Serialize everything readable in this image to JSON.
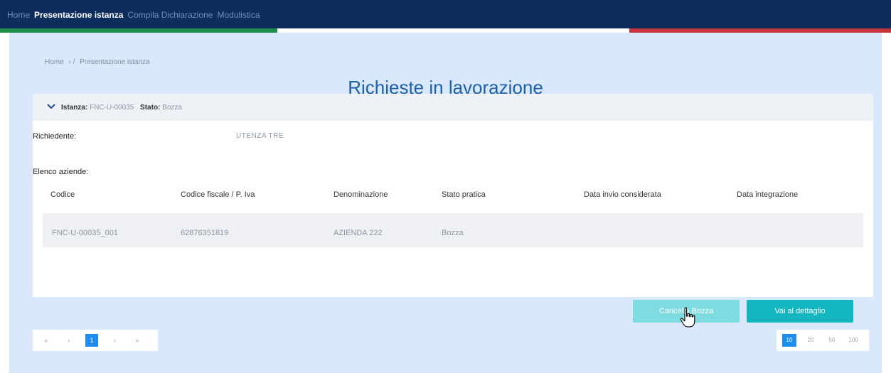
{
  "nav": {
    "items": [
      {
        "label": "Home",
        "active": false
      },
      {
        "label": "Presentazione istanza",
        "active": true
      },
      {
        "label": "Compila Dichiarazione",
        "active": false
      },
      {
        "label": "Modulistica",
        "active": false
      }
    ]
  },
  "breadcrumb": {
    "home": "Home",
    "sep": "› /",
    "current": "Presentazione istanza"
  },
  "page": {
    "title": "Richieste in lavorazione"
  },
  "panel": {
    "istanza_label": "Istanza:",
    "istanza_value": "FNC-U-00035",
    "stato_label": "Stato:",
    "stato_value": "Bozza",
    "richiedente_label": "Richiedente:",
    "richiedente_value": "UTENZA TRE",
    "elenco_label": "Elenco aziende:"
  },
  "table": {
    "headers": [
      "Codice",
      "Codice fiscale / P. Iva",
      "Denominazione",
      "Stato pratica",
      "Data invio considerata",
      "Data integrazione"
    ],
    "rows": [
      [
        "FNC-U-00035_001",
        "62876351819",
        "AZIENDA 222",
        "Bozza",
        "",
        ""
      ]
    ]
  },
  "buttons": {
    "cancel": "Cancella Bozza",
    "detail": "Vai al dettaglio"
  },
  "pagination": {
    "first": "«",
    "prev": "‹",
    "current": "1",
    "next": "›",
    "last": "»"
  },
  "page_size": {
    "options": [
      "10",
      "20",
      "50",
      "100"
    ],
    "selected": "10"
  },
  "colors": {
    "nav": "#0d2d5c",
    "accent": "#1d5fa8",
    "teal": "#13b6be",
    "content_bg": "#d9e8fb"
  }
}
